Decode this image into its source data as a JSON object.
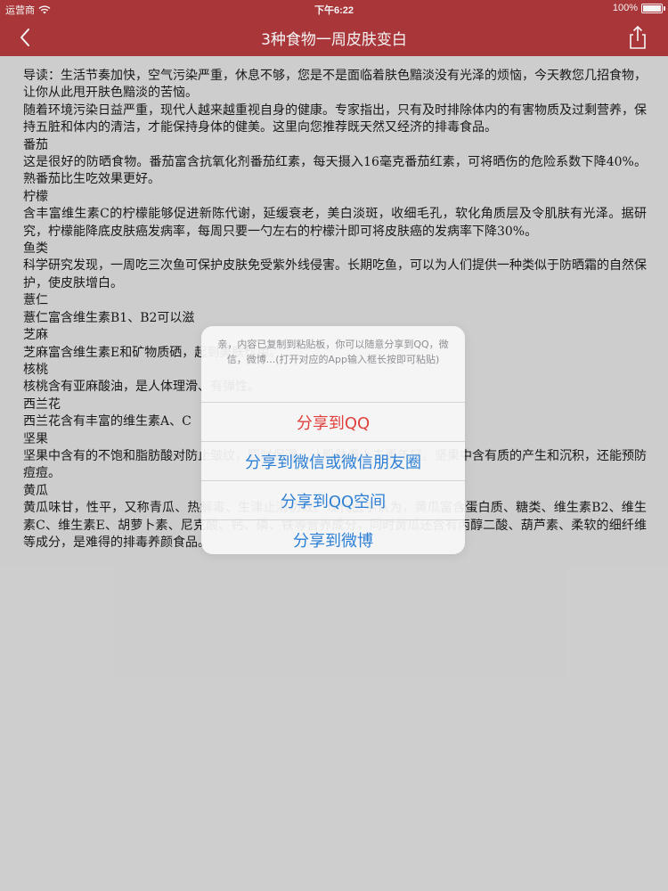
{
  "status_bar": {
    "carrier": "运营商",
    "time": "下午6:22",
    "battery": "100%",
    "battery_level": 1.0
  },
  "nav": {
    "back_icon": "chevron-left-icon",
    "title": "3种食物一周皮肤变白",
    "share_icon": "share-icon"
  },
  "article": {
    "paragraphs": [
      "导读：生活节奏加快，空气污染严重，休息不够，您是不是面临着肤色黯淡没有光泽的烦恼，今天教您几招食物，让你从此甩开肤色黯淡的苦恼。",
      "随着环境污染日益严重，现代人越来越重视自身的健康。专家指出，只有及时排除体内的有害物质及过剩营养，保持五脏和体内的清洁，才能保持身体的健美。这里向您推荐既天然又经济的排毒食品。",
      "番茄",
      "这是很好的防晒食物。番茄富含抗氧化剂番茄红素，每天摄入16毫克番茄红素，可将晒伤的危险系数下降40%。熟番茄比生吃效果更好。",
      "柠檬",
      "含丰富维生素C的柠檬能够促进新陈代谢，延缓衰老，美白淡斑，收细毛孔，软化角质层及令肌肤有光泽。据研究，柠檬能降底皮肤癌发病率，每周只要一勺左右的柠檬汁即可将皮肤癌的发病率下降30%。",
      "鱼类",
      "科学研究发现，一周吃三次鱼可保护皮肤免受紫外线侵害。长期吃鱼，可以为人们提供一种类似于防晒霜的自然保护，使皮肤增白。",
      "薏仁",
      "薏仁富含维生素B1、B2可以滋",
      "芝麻",
      "芝麻富含维生素E和矿物质硒，起到美肤作用。",
      "核桃",
      "核桃含有亚麻酸油，是人体理滑、有弹性。",
      "西兰花",
      "西兰花含有丰富的维生素A、C",
      "坚果",
      "坚果中含有的不饱和脂肪酸对防止皱纹，同时保湿，让肌肤看上去更年轻。坚果中含有质的产生和沉积，还能预防痘痘。",
      "黄瓜",
      "黄瓜味甘，性平，又称青瓜、热解毒、生津止渴功效。现代医学认为，黄瓜富含蛋白质、糖类、维生素B2、维生素C、维生素E、胡萝卜素、尼克酸、钙、磷、铁等营养成分，同时黄瓜还含有丙醇二酸、葫芦素、柔软的细纤维等成分，是难得的排毒养颜食品。"
    ]
  },
  "share_sheet": {
    "message": "亲，内容已复制到粘贴板，你可以随意分享到QQ，微信，微博...(打开对应的App输入框长按即可粘贴)",
    "options": [
      "分享到QQ",
      "分享到微信或微信朋友圈",
      "分享到QQ空间",
      "分享到微博"
    ]
  },
  "colors": {
    "header": "#b03a3d",
    "background": "#d6d6d6",
    "sheet_action": "#2d7fd5",
    "sheet_destructive": "#e0403c"
  }
}
